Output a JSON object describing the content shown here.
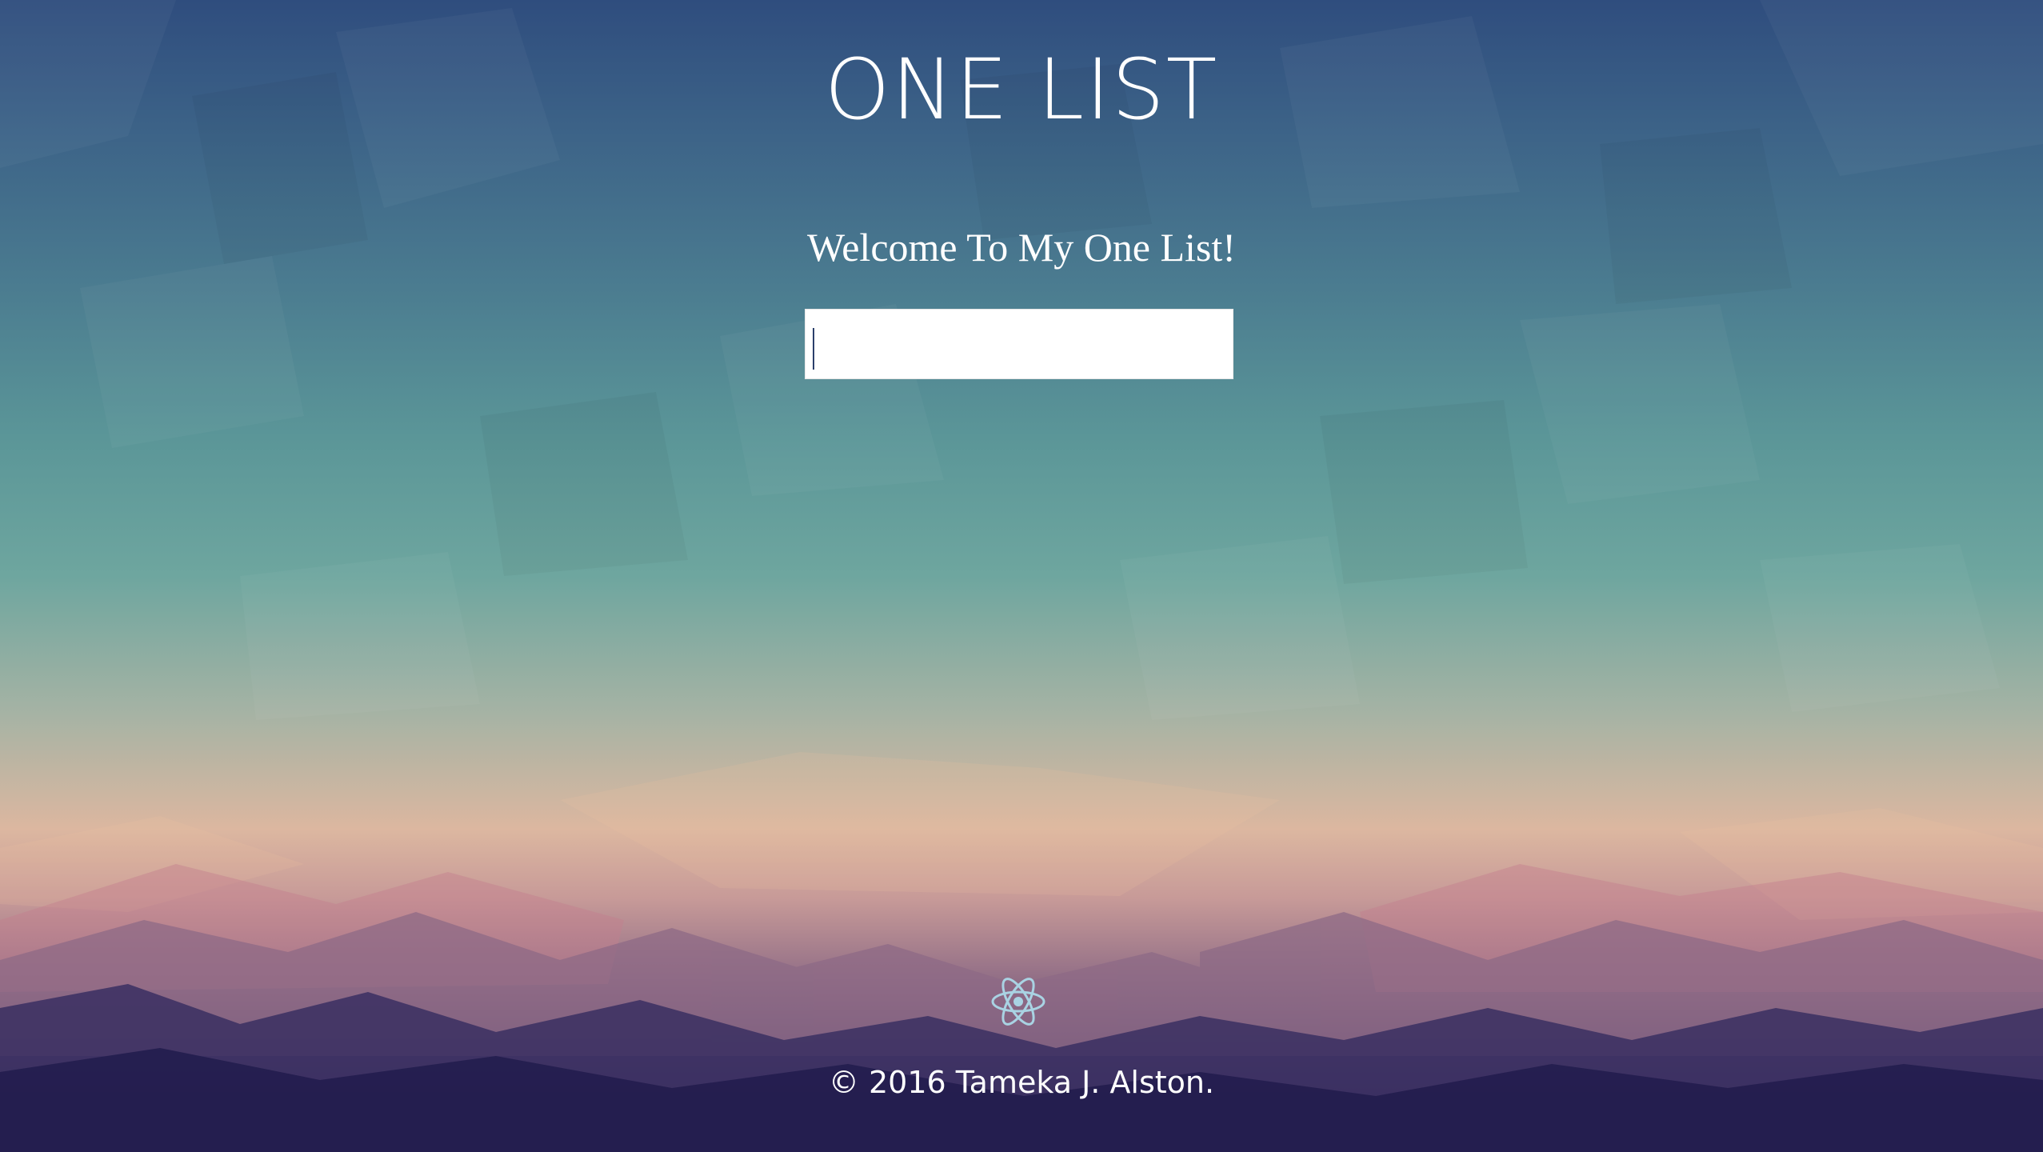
{
  "header": {
    "title": "ONE LIST"
  },
  "main": {
    "welcome_text": "Welcome To My One List!",
    "todo_input": {
      "value": "",
      "placeholder": ""
    }
  },
  "footer": {
    "icon": "react-atom-icon",
    "copyright": "© 2016 Tameka J. Alston."
  },
  "colors": {
    "sky_top": "#2f4d7e",
    "sky_mid": "#5b9698",
    "horizon_peach": "#dcb7a0",
    "ground_purple": "#2a2558",
    "text": "#ffffff",
    "icon": "#a9d3e3"
  }
}
